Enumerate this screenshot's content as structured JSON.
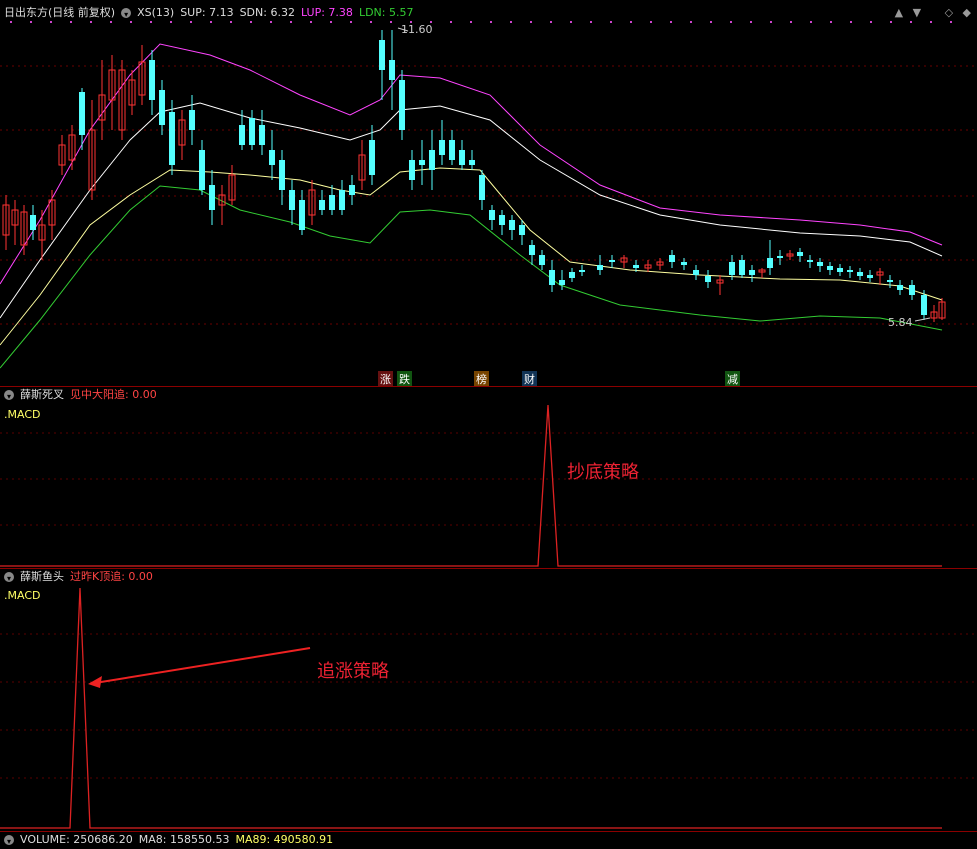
{
  "main": {
    "title": "日出东方(日线 前复权)",
    "indicator_name": "XS(13)",
    "sup": "SUP: 7.13",
    "sdn": "SDN: 6.32",
    "lup": "LUP: 7.38",
    "ldn": "LDN: 5.57",
    "high_label": "11.60",
    "low_label": "5.84",
    "markers": [
      "涨",
      "跌",
      "榜",
      "财",
      "减"
    ],
    "colors": {
      "up": "#ff3333",
      "down": "#54ffff",
      "sup": "#ffffa0",
      "sdn": "#ffffff",
      "lup": "#ff44ff",
      "ldn": "#33cc33"
    }
  },
  "panel2": {
    "dropdown_icon": "chevron-down-icon",
    "name": "薛斯死叉",
    "param": "见中大阳追: 0.00",
    "sub": ".MACD",
    "annotation": "抄底策略"
  },
  "panel3": {
    "dropdown_icon": "chevron-down-icon",
    "name": "薛斯鱼头",
    "param": "过昨K顶追: 0.00",
    "sub": ".MACD",
    "annotation": "追涨策略"
  },
  "volume": {
    "volume": "VOLUME: 250686.20",
    "ma8": "MA8: 158550.53",
    "ma89": "MA89: 490580.91"
  },
  "controls": {
    "up": "▲",
    "down": "▼",
    "reset": "◇",
    "close": "◆"
  }
}
